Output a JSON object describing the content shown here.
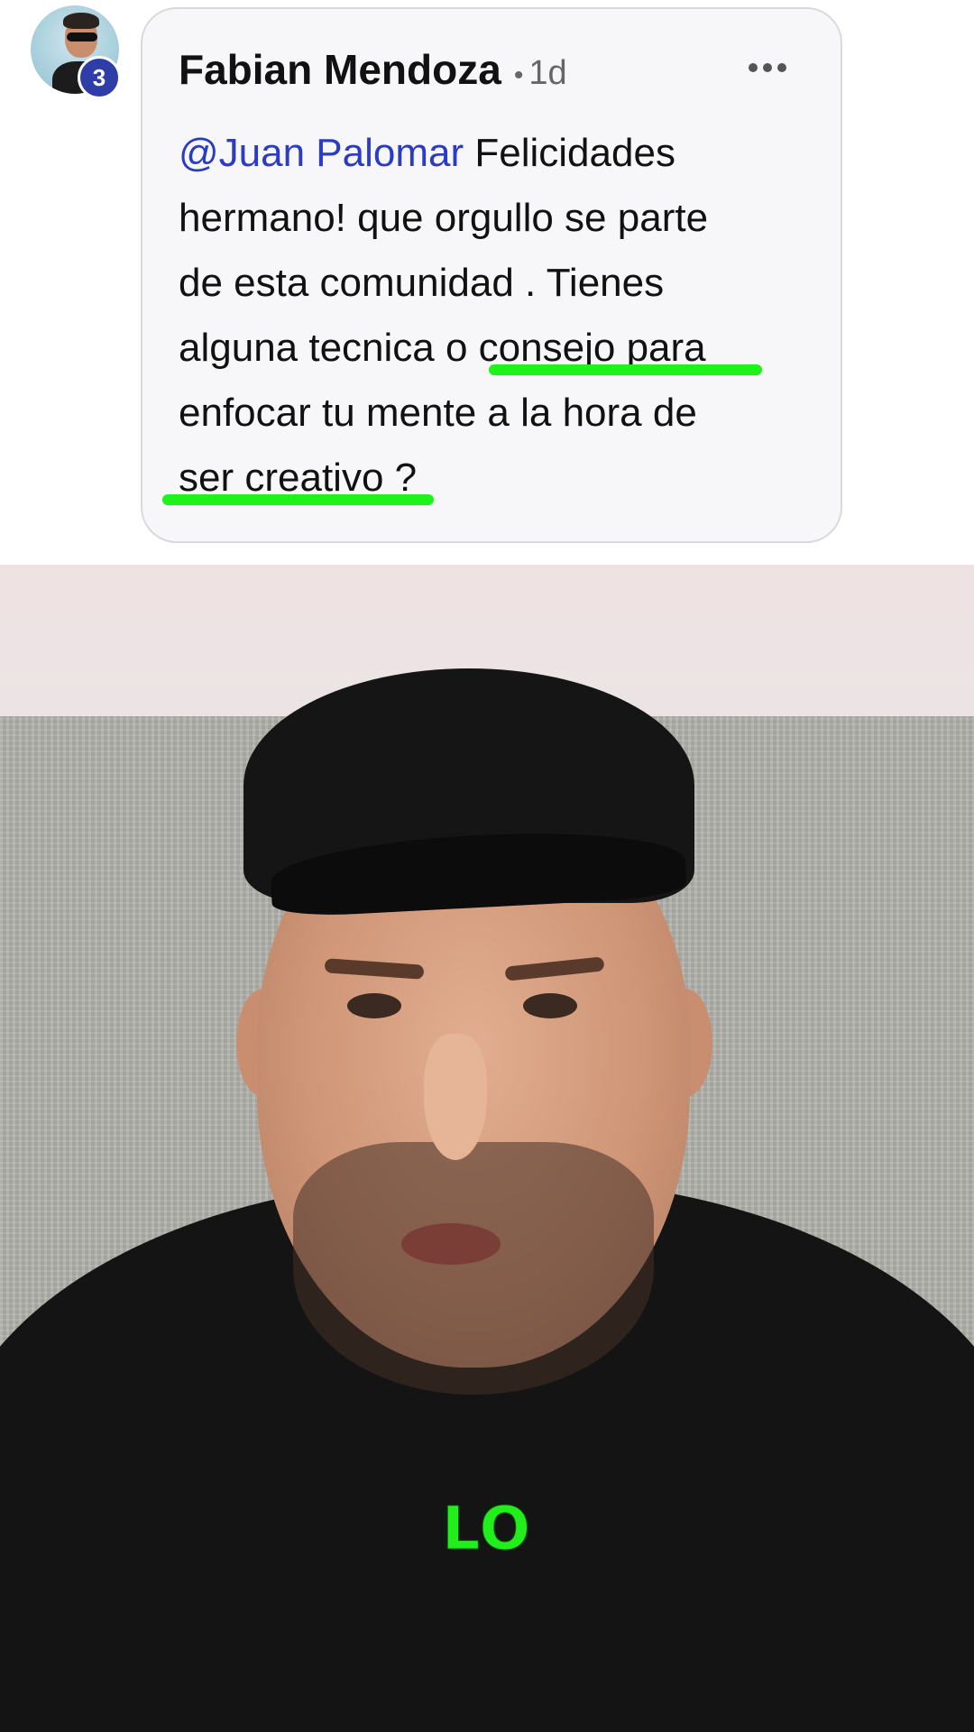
{
  "comment": {
    "author": "Fabian Mendoza",
    "separator": "•",
    "time": "1d",
    "badge_count": "3",
    "lines": [
      {
        "mention": "@Juan Palomar",
        "text": " Felicidades"
      },
      {
        "mention": "",
        "text": "hermano! que orgullo se parte"
      },
      {
        "mention": "",
        "text": "de esta comunidad . Tienes"
      },
      {
        "mention": "",
        "text": "alguna tecnica o consejo para"
      },
      {
        "mention": "",
        "text": "enfocar tu mente a la hora de"
      },
      {
        "mention": "",
        "text": "ser creativo ?"
      }
    ],
    "highlight_color": "#1df21b",
    "mention_color": "#2b3cc4"
  },
  "video": {
    "caption": "LO",
    "caption_color": "#22ee1c"
  }
}
